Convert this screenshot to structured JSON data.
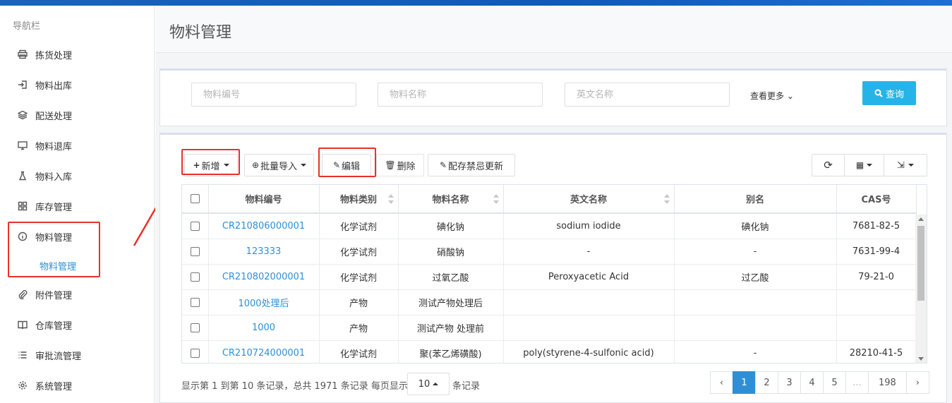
{
  "sidebar": {
    "title": "导航栏",
    "items": [
      {
        "label": "拣货处理",
        "icon": "printer-icon"
      },
      {
        "label": "物料出库",
        "icon": "sign-in-icon"
      },
      {
        "label": "配送处理",
        "icon": "layers-icon"
      },
      {
        "label": "物料退库",
        "icon": "monitor-icon"
      },
      {
        "label": "物料入库",
        "icon": "flask-icon"
      },
      {
        "label": "库存管理",
        "icon": "grid-icon"
      },
      {
        "label": "物料管理",
        "icon": "info-circle-icon"
      },
      {
        "label": "附件管理",
        "icon": "paperclip-icon"
      },
      {
        "label": "仓库管理",
        "icon": "book-icon"
      },
      {
        "label": "审批流管理",
        "icon": "list-icon"
      },
      {
        "label": "系统管理",
        "icon": "gear-icon"
      }
    ],
    "active_sub": "物料管理"
  },
  "page": {
    "title": "物料管理"
  },
  "search": {
    "code_placeholder": "物料编号",
    "name_placeholder": "物料名称",
    "english_placeholder": "英文名称",
    "more": "查看更多",
    "query": "查询"
  },
  "toolbar": {
    "add": "新增",
    "batch_import": "批量导入",
    "edit": "编辑",
    "delete": "删除",
    "stock_update": "配存禁忌更新"
  },
  "table": {
    "headers": [
      "物料编号",
      "物料类别",
      "物料名称",
      "英文名称",
      "别名",
      "CAS号"
    ],
    "rows": [
      {
        "code": "CR210806000001",
        "category": "化学试剂",
        "name": "碘化钠",
        "english": "sodium iodide",
        "alias": "碘化钠",
        "cas": "7681-82-5"
      },
      {
        "code": "123333",
        "category": "化学试剂",
        "name": "硝酸钠",
        "english": "-",
        "alias": "-",
        "cas": "7631-99-4"
      },
      {
        "code": "CR210802000001",
        "category": "化学试剂",
        "name": "过氧乙酸",
        "english": "Peroxyacetic Acid",
        "alias": "过乙酸",
        "cas": "79-21-0"
      },
      {
        "code": "1000处理后",
        "category": "产物",
        "name": "测试产物处理后",
        "english": "",
        "alias": "",
        "cas": ""
      },
      {
        "code": "1000",
        "category": "产物",
        "name": "测试产物 处理前",
        "english": "",
        "alias": "",
        "cas": ""
      },
      {
        "code": "CR210724000001",
        "category": "化学试剂",
        "name": "聚(苯乙烯磺酸)",
        "english": "poly(styrene-4-sulfonic acid)",
        "alias": "-",
        "cas": "28210-41-5"
      }
    ]
  },
  "footer": {
    "summary": "显示第 1 到第 10 条记录，总共 1971 条记录 每页显示",
    "page_size": "10",
    "suffix": "条记录",
    "pages": [
      "‹",
      "1",
      "2",
      "3",
      "4",
      "5",
      "...",
      "198",
      "›"
    ]
  },
  "colors": {
    "accent": "#2e8fd6",
    "query": "#26b4e8",
    "highlight": "#e8322b"
  }
}
